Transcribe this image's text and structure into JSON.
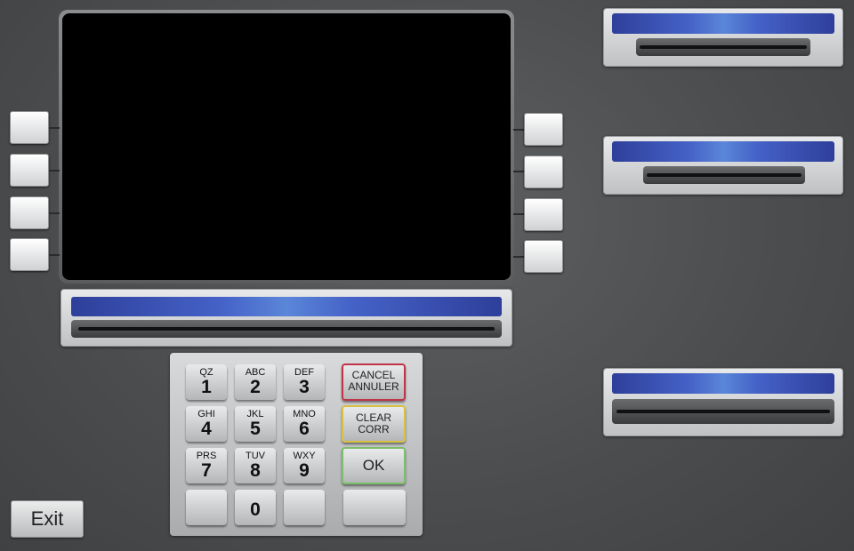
{
  "keypad": {
    "keys": [
      {
        "letters": "QZ",
        "digit": "1"
      },
      {
        "letters": "ABC",
        "digit": "2"
      },
      {
        "letters": "DEF",
        "digit": "3"
      },
      {
        "letters": "GHI",
        "digit": "4"
      },
      {
        "letters": "JKL",
        "digit": "5"
      },
      {
        "letters": "MNO",
        "digit": "6"
      },
      {
        "letters": "PRS",
        "digit": "7"
      },
      {
        "letters": "TUV",
        "digit": "8"
      },
      {
        "letters": "WXY",
        "digit": "9"
      },
      {
        "letters": "",
        "digit": "0"
      }
    ],
    "cancel": {
      "line1": "CANCEL",
      "line2": "ANNULER"
    },
    "clear": {
      "line1": "CLEAR",
      "line2": "CORR"
    },
    "ok": "OK"
  },
  "exit_label": "Exit",
  "colors": {
    "slot_light": "#4562c8",
    "cancel_border": "#c0344a",
    "clear_border": "#d8c040",
    "ok_border": "#7cbf6a"
  }
}
